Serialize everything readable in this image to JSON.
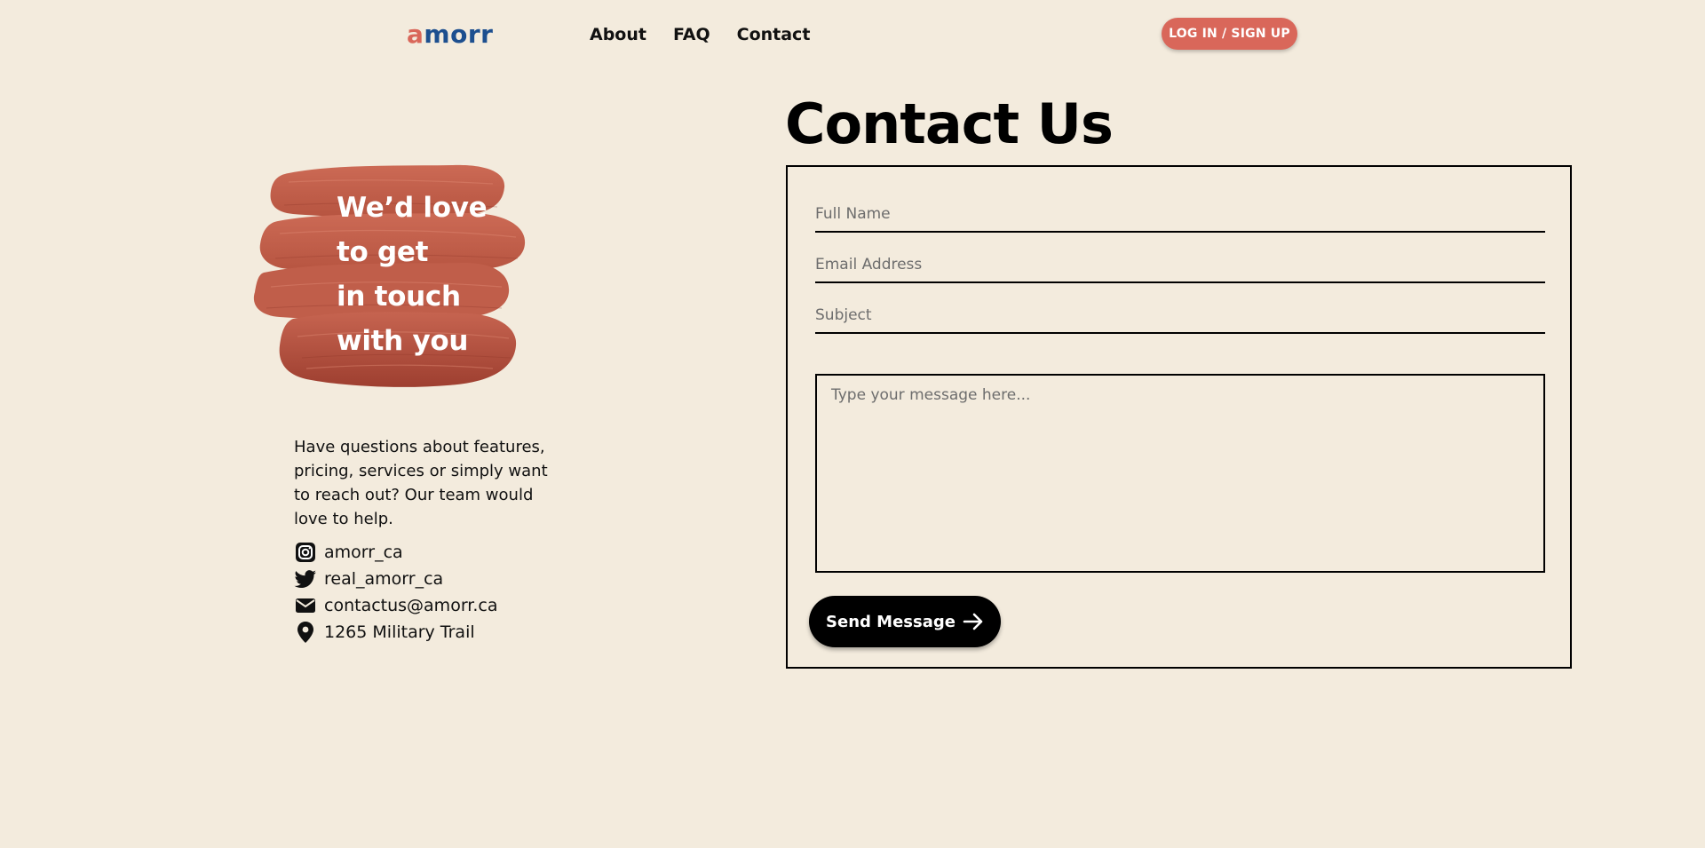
{
  "header": {
    "logo_first": "a",
    "logo_rest": "morr",
    "nav": [
      {
        "label": "About"
      },
      {
        "label": "FAQ"
      },
      {
        "label": "Contact"
      }
    ],
    "login_label": "LOG IN / SIGN UP"
  },
  "left": {
    "tagline": [
      "We’d love",
      "to get",
      "in touch",
      "with you"
    ],
    "intro": "Have questions about features, pricing, services or simply want to reach out? Our team would love to help.",
    "contacts": [
      {
        "icon": "instagram-icon",
        "text": "amorr_ca"
      },
      {
        "icon": "twitter-icon",
        "text": "real_amorr_ca"
      },
      {
        "icon": "mail-icon",
        "text": "contactus@amorr.ca"
      },
      {
        "icon": "location-pin-icon",
        "text": "1265 Military Trail"
      }
    ]
  },
  "form": {
    "title": "Contact Us",
    "full_name_placeholder": "Full Name",
    "email_placeholder": "Email Address",
    "subject_placeholder": "Subject",
    "message_placeholder": "Type your message here...",
    "send_label": "Send Message"
  },
  "colors": {
    "background": "#f3ebdd",
    "accent": "#d9675a",
    "logo_blue": "#1d4f8f",
    "brush": "#c0604c"
  }
}
